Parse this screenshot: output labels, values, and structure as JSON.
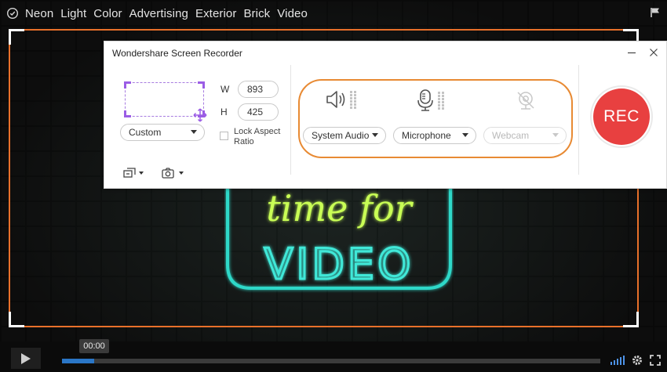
{
  "player": {
    "tags": [
      "Neon",
      "Light",
      "Color",
      "Advertising",
      "Exterior",
      "Brick",
      "Video"
    ],
    "current_time": "00:00",
    "progress_fraction": 0.06,
    "accent_color": "#e8702a"
  },
  "sign": {
    "line1": "time for",
    "line2": "VIDEO"
  },
  "recorder": {
    "title": "Wondershare Screen Recorder",
    "area_preset": "Custom",
    "width_label": "W",
    "width_value": "893",
    "height_label": "H",
    "height_value": "425",
    "lock_aspect_label_1": "Lock Aspect",
    "lock_aspect_label_2": "Ratio",
    "system_audio": "System Audio",
    "microphone": "Microphone",
    "webcam": "Webcam",
    "rec_label": "REC",
    "rec_color": "#e84040",
    "group_border_color": "#e88a33"
  }
}
